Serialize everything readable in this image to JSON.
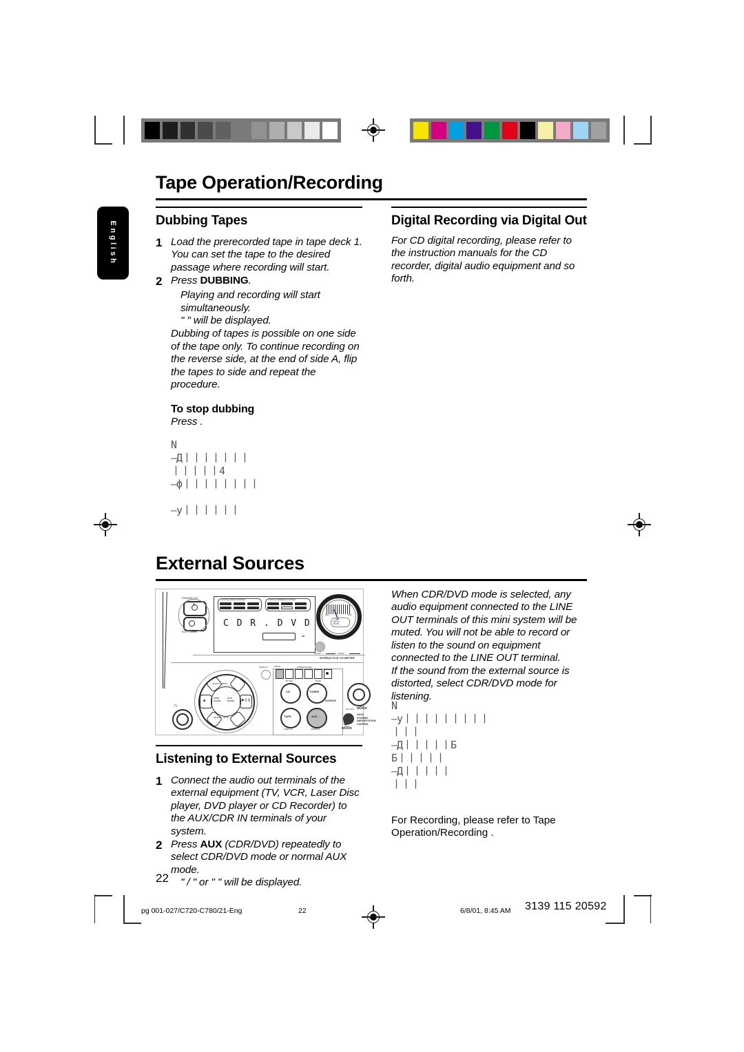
{
  "page": {
    "title": "Tape Operation/Recording",
    "section2_title": "External Sources",
    "side_tab": "English",
    "page_number": "22"
  },
  "dubbing": {
    "heading": "Dubbing Tapes",
    "steps": [
      {
        "num": "1",
        "text": "Load the prerecorded tape in tape deck 1. You can set the tape to the desired passage where recording will start."
      },
      {
        "num": "2",
        "text": "Press DUBBING."
      }
    ],
    "step2_bold": "DUBBING",
    "step2_prefix": "Press ",
    "step2_suffix": ".",
    "sub1": "Playing and recording will start simultaneously.",
    "sub2": "\"                \" will be displayed.",
    "para": "Dubbing of tapes is possible on one side of the tape only.  To continue recording on the reverse side, at the end of side A, flip the tapes to side  and repeat the procedure.",
    "stop_heading": "To stop dubbing",
    "stop_text": "Press      .",
    "garbled": "N\n—Д丨丨丨丨丨丨丨\n丨丨丨丨丨4\n—ф丨丨丨丨丨丨丨丨\n\n—у丨丨丨丨丨丨"
  },
  "digital": {
    "heading": "Digital Recording via Digital Out",
    "text": "For CD digital recording, please refer to the instruction manuals for the CD recorder, digital audio equipment and so forth."
  },
  "external": {
    "note1": "When CDR/DVD mode is selected, any audio equipment connected to the LINE OUT terminals of this mini system will be muted.  You will not be able to record or listen to the sound on equipment connected to the LINE OUT terminal.",
    "note2": "If the sound from the external source is distorted, select CDR/DVD mode for listening.",
    "garbled": "N\n—у丨丨丨丨丨丨丨丨丨\n丨丨丨\n—Д丨丨丨丨丨Б\nБ丨丨丨丨丨\n—Д丨丨丨丨丨\n丨丨丨",
    "recording_note": "For Recording, please refer to  Tape Operation/Recording ."
  },
  "listening": {
    "heading": "Listening to External Sources",
    "step1_num": "1",
    "step1_text": "Connect the audio out terminals of the external equipment (TV, VCR, Laser Disc player, DVD player or CD Recorder) to the AUX/CDR IN terminals of your system.",
    "step2_num": "2",
    "step2_pre": "Press ",
    "step2_bold": "AUX",
    "step2_post": " (CDR/DVD) repeatedly to select CDR/DVD mode or normal AUX mode.",
    "step2_sub": "\"      /       \" or \"        \" will be displayed."
  },
  "device": {
    "standby_label": "STANDBY-ON",
    "eco_label": "ECO POWER",
    "dsc_label": "DIGITAL SOUND CONTROL",
    "vec_label": "VIRTUAL AMBIENCE CONTROL",
    "dsc_buttons": [
      "DIGITAL",
      "POP",
      "CLASSIC",
      "ROCK",
      "OPTIMAL",
      "TECHNO"
    ],
    "vec_buttons": [
      "HALL",
      "CHURCH",
      "ARCADE",
      "STADIUM",
      "CLUB",
      "CINEMA"
    ],
    "lcd_text": "C D R . D V D",
    "vu_label": "INTERACTIVE VU METER",
    "music_label": "MUSIC",
    "level_label": "LEVEL",
    "vu_brand": "VU dB\nPHILIPS",
    "display_btn": "DISPLAY",
    "prog_label": "PROG",
    "rec_label": "DUBBING  REC",
    "source_label": "SOURCE",
    "source_buttons": [
      "CD",
      "TUNER",
      "TAPE",
      "AUX"
    ],
    "cd_neg": "CD NEG",
    "band": "BAND",
    "tape_label": "TAPE 1-2",
    "cdrdvd_label": "CDR/DVD",
    "woox_label": "wOOx",
    "woox_sub": "wOOx\nDYNAMIC\nAMPLIFICATION\nCONTROL",
    "onoff_label": "ON  OFF",
    "transport": [
      "STOP",
      "CLEAR",
      "PLAY",
      "PAUSE"
    ],
    "headphone_icon": "headphone-icon"
  },
  "footer": {
    "file": "pg 001-027/C720-C780/21-Eng",
    "page": "22",
    "timestamp": "6/8/01, 8:45 AM",
    "code": "3139 115 20592"
  },
  "swatches": {
    "gray": [
      "#000000",
      "#1d1d1d",
      "#313131",
      "#4b4b4b",
      "#616161",
      "#7b7b7b",
      "#919191",
      "#aeaeae",
      "#c9c9c9",
      "#eaeaea",
      "#ffffff"
    ],
    "color": [
      "#f5e400",
      "#d5007f",
      "#00a0e1",
      "#45108a",
      "#00963f",
      "#e2001a",
      "#000000",
      "#f9f0a8",
      "#f5aac8",
      "#9fd5f2",
      "#a0a0a0"
    ]
  }
}
